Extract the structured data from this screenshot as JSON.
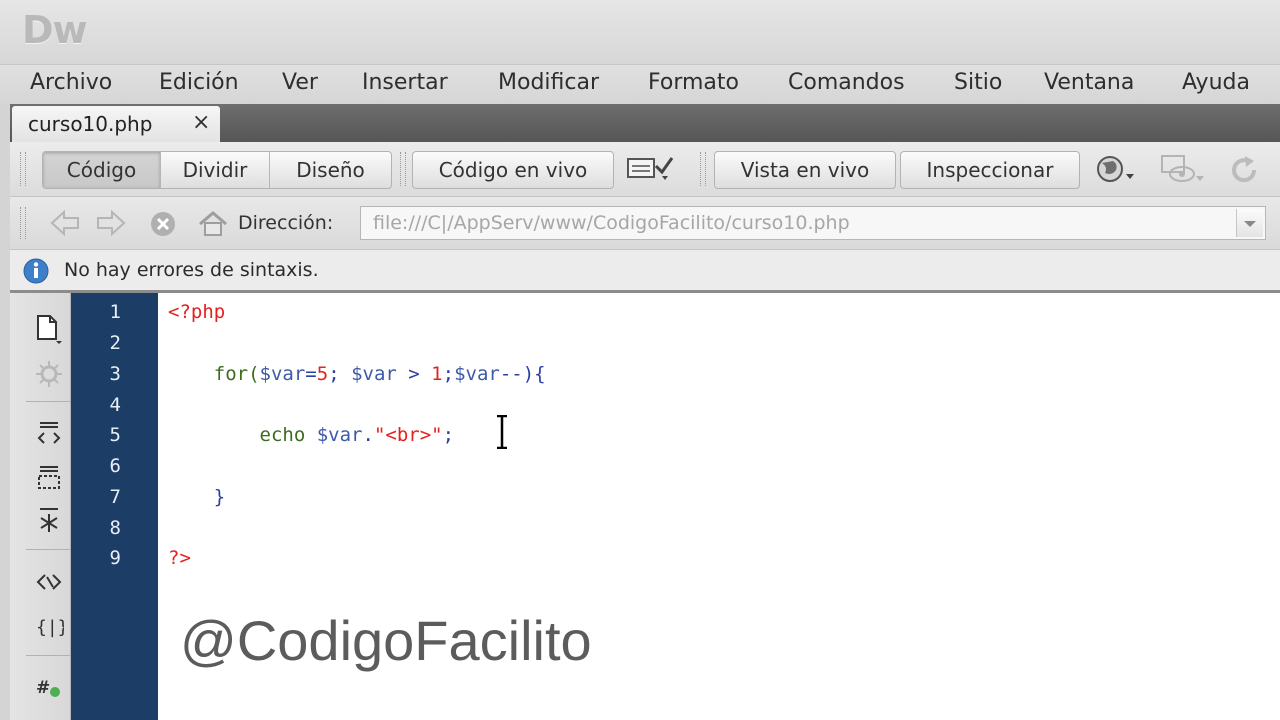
{
  "app": {
    "logo": "Dw"
  },
  "menu": [
    "Archivo",
    "Edición",
    "Ver",
    "Insertar",
    "Modificar",
    "Formato",
    "Comandos",
    "Sitio",
    "Ventana",
    "Ayuda"
  ],
  "tab": {
    "label": "curso10.php",
    "close": "×"
  },
  "view_buttons": {
    "code": "Código",
    "split": "Dividir",
    "design": "Diseño"
  },
  "toolbar": {
    "live_code": "Código en vivo",
    "live_view": "Vista en vivo",
    "inspect": "Inspeccionar"
  },
  "address": {
    "label": "Dirección:",
    "value": "file:///C|/AppServ/www/CodigoFacilito/curso10.php"
  },
  "status": {
    "message": "No hay errores de sintaxis."
  },
  "editor": {
    "line_numbers": [
      "1",
      "2",
      "3",
      "4",
      "5",
      "6",
      "7",
      "8",
      "9"
    ],
    "lines": [
      {
        "segments": [
          {
            "t": "<?php",
            "c": "php"
          }
        ]
      },
      {
        "segments": []
      },
      {
        "segments": [
          {
            "t": "    for(",
            "c": "kw"
          },
          {
            "t": "$var",
            "c": "var"
          },
          {
            "t": "=",
            "c": "op"
          },
          {
            "t": "5",
            "c": "num"
          },
          {
            "t": "; ",
            "c": "op"
          },
          {
            "t": "$var",
            "c": "var"
          },
          {
            "t": " > ",
            "c": "op"
          },
          {
            "t": "1",
            "c": "num"
          },
          {
            "t": ";",
            "c": "op"
          },
          {
            "t": "$var",
            "c": "var"
          },
          {
            "t": "--){",
            "c": "op"
          }
        ]
      },
      {
        "segments": []
      },
      {
        "segments": [
          {
            "t": "        echo ",
            "c": "kw"
          },
          {
            "t": "$var",
            "c": "var"
          },
          {
            "t": ".",
            "c": "op"
          },
          {
            "t": "\"<br>\"",
            "c": "str"
          },
          {
            "t": ";",
            "c": "op"
          }
        ]
      },
      {
        "segments": []
      },
      {
        "segments": [
          {
            "t": "    }",
            "c": "op"
          }
        ]
      },
      {
        "segments": []
      },
      {
        "segments": [
          {
            "t": "?>",
            "c": "php"
          }
        ]
      }
    ]
  },
  "watermark": "@CodigoFacilito",
  "icons": {
    "info": "info-icon",
    "nav": [
      "back-arrow-icon",
      "forward-arrow-icon",
      "stop-icon",
      "home-icon"
    ],
    "globe": "globe-icon",
    "refresh": "refresh-icon"
  }
}
